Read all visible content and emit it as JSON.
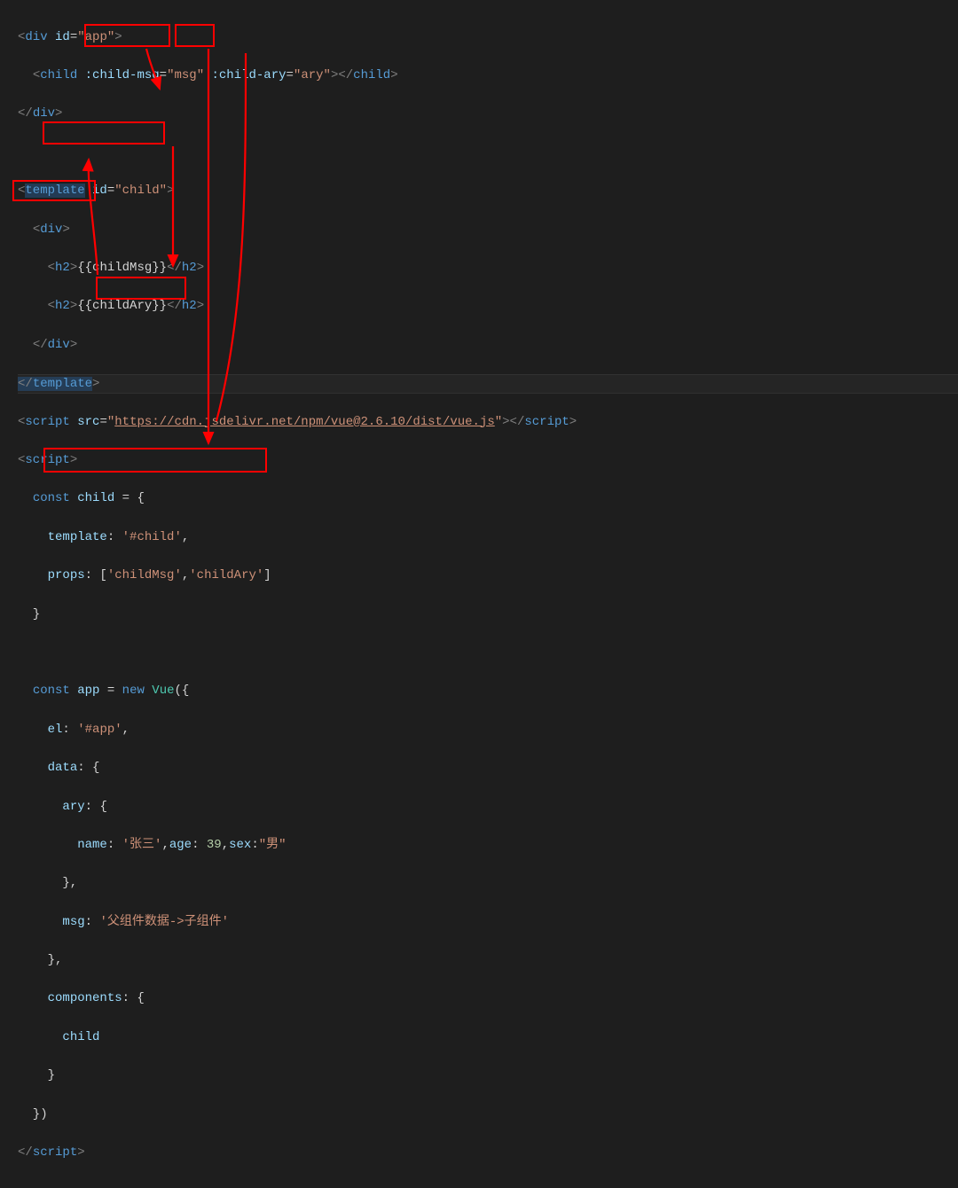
{
  "colors": {
    "highlight": "#ff0000"
  },
  "line1": {
    "open": "<",
    "tag": "div",
    "sp": " ",
    "attr": "id",
    "eq": "=",
    "q": "\"",
    "val": "app",
    "close": ">"
  },
  "line2": {
    "open": "<",
    "tag": "child",
    "a1": ":child-msg",
    "v1": "msg",
    "a2": ":child-ary",
    "v2": "ary",
    "closeOpen": "></",
    "closeTag": "child",
    "close": ">",
    "eq": "=",
    "q": "\""
  },
  "line3": {
    "open": "</",
    "tag": "div",
    "close": ">"
  },
  "line5": {
    "open": "<",
    "tag": "template",
    "attr": "id",
    "eq": "=",
    "q": "\"",
    "val": "child",
    "close": ">"
  },
  "line6": {
    "open": "<",
    "tag": "div",
    "close": ">"
  },
  "line7": {
    "open": "<",
    "tag": "h2",
    "close": ">",
    "content": "{{childMsg}}",
    "closeTag": "</",
    "close2": ">"
  },
  "line8": {
    "open": "<",
    "tag": "h2",
    "close": ">",
    "content": "{{childAry}}",
    "closeTag": "</",
    "close2": ">"
  },
  "line9": {
    "open": "</",
    "tag": "div",
    "close": ">"
  },
  "line10": {
    "open": "</",
    "tag": "template",
    "close": ">"
  },
  "line11": {
    "open": "<",
    "tag": "script",
    "attr": "src",
    "eq": "=",
    "q": "\"",
    "val": "https://cdn.jsdelivr.net/npm/vue@2.6.10/dist/vue.js",
    "close": "></",
    "close2": ">"
  },
  "line12": {
    "open": "<",
    "tag": "script",
    "close": ">"
  },
  "js": {
    "const": "const",
    "new": "new",
    "childVar": "child",
    "template": "template",
    "templateVal": "'#child'",
    "props": "props",
    "propsVal1": "'childMsg'",
    "propsVal2": "'childAry'",
    "appVar": "app",
    "Vue": "Vue",
    "el": "el",
    "elVal": "'#app'",
    "data": "data",
    "ary": "ary",
    "name": "name",
    "nameVal": "'张三'",
    "age": "age",
    "ageVal": "39",
    "sex": "sex",
    "sexVal": "\"男\"",
    "msg": "msg",
    "msgVal": "'父组件数据->子组件'",
    "components": "components",
    "childRef": "child"
  },
  "lineEnd": {
    "open": "</",
    "tag": "script",
    "close": ">"
  }
}
